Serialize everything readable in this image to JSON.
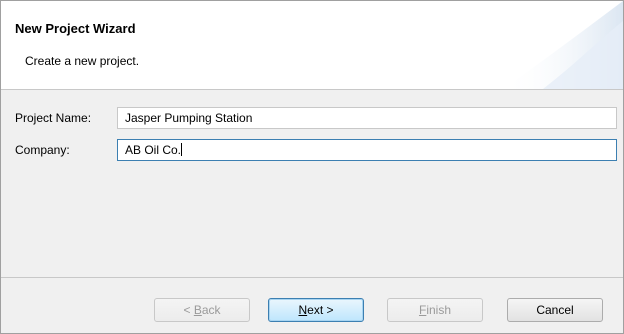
{
  "header": {
    "title": "New Project Wizard",
    "subtitle": "Create a new project."
  },
  "form": {
    "project_name": {
      "label": "Project Name:",
      "value": "Jasper Pumping Station"
    },
    "company": {
      "label": "Company:",
      "value": "AB Oil Co."
    }
  },
  "buttons": {
    "back": {
      "prefix": "< ",
      "mnemonic": "B",
      "rest": "ack",
      "enabled": false
    },
    "next": {
      "mnemonic": "N",
      "rest": "ext >",
      "enabled": true
    },
    "finish": {
      "mnemonic": "F",
      "rest": "inish",
      "enabled": false
    },
    "cancel": {
      "label": "Cancel",
      "enabled": true
    }
  },
  "colors": {
    "header_bg": "#ffffff",
    "body_bg": "#f0f0f0",
    "focus_border": "#3c7fb1",
    "disabled_text": "#9a9a9a"
  }
}
